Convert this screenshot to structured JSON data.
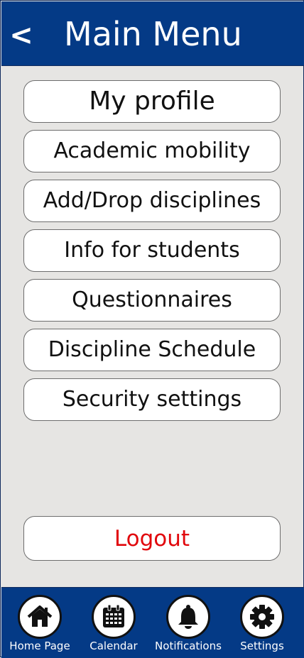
{
  "header": {
    "back_label": "<",
    "title": "Main Menu"
  },
  "menu": {
    "items": [
      {
        "label": "My profile"
      },
      {
        "label": "Academic mobility"
      },
      {
        "label": "Add/Drop disciplines"
      },
      {
        "label": "Info for students"
      },
      {
        "label": "Questionnaires"
      },
      {
        "label": "Discipline Schedule"
      },
      {
        "label": "Security settings"
      }
    ],
    "logout_label": "Logout"
  },
  "bottom_nav": {
    "items": [
      {
        "label": "Home Page",
        "icon": "home-icon"
      },
      {
        "label": "Calendar",
        "icon": "calendar-icon"
      },
      {
        "label": "Notifications",
        "icon": "bell-icon"
      },
      {
        "label": "Settings",
        "icon": "gear-icon"
      }
    ]
  },
  "colors": {
    "header_bg": "#043a86",
    "page_bg": "#e6e5e3",
    "button_bg": "#ffffff",
    "logout_text": "#e1070c"
  }
}
